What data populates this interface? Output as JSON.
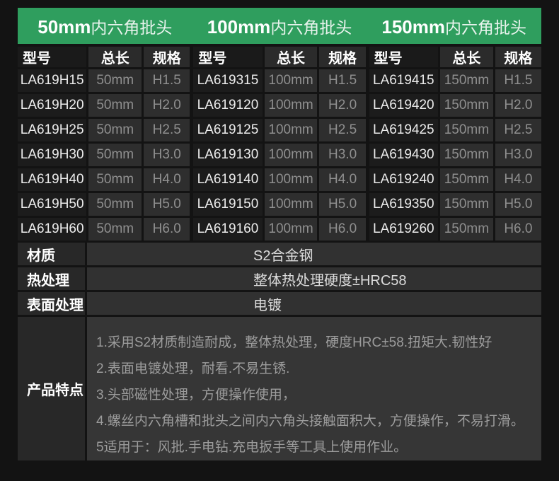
{
  "colors": {
    "accent_green": "#2f9e5e",
    "background": "#131313"
  },
  "groups": [
    {
      "title_size": "50mm",
      "title_suffix": "内六角批头",
      "headers": [
        "型号",
        "总长",
        "规格"
      ],
      "rows": [
        [
          "LA619H15",
          "50mm",
          "H1.5"
        ],
        [
          "LA619H20",
          "50mm",
          "H2.0"
        ],
        [
          "LA619H25",
          "50mm",
          "H2.5"
        ],
        [
          "LA619H30",
          "50mm",
          "H3.0"
        ],
        [
          "LA619H40",
          "50mm",
          "H4.0"
        ],
        [
          "LA619H50",
          "50mm",
          "H5.0"
        ],
        [
          "LA619H60",
          "50mm",
          "H6.0"
        ]
      ]
    },
    {
      "title_size": "100mm",
      "title_suffix": "内六角批头",
      "headers": [
        "型号",
        "总长",
        "规格"
      ],
      "rows": [
        [
          "LA619315",
          "100mm",
          "H1.5"
        ],
        [
          "LA619120",
          "100mm",
          "H2.0"
        ],
        [
          "LA619125",
          "100mm",
          "H2.5"
        ],
        [
          "LA619130",
          "100mm",
          "H3.0"
        ],
        [
          "LA619140",
          "100mm",
          "H4.0"
        ],
        [
          "LA619150",
          "100mm",
          "H5.0"
        ],
        [
          "LA619160",
          "100mm",
          "H6.0"
        ]
      ]
    },
    {
      "title_size": "150mm",
      "title_suffix": "内六角批头",
      "headers": [
        "型号",
        "总长",
        "规格"
      ],
      "rows": [
        [
          "LA619415",
          "150mm",
          "H1.5"
        ],
        [
          "LA619420",
          "150mm",
          "H2.0"
        ],
        [
          "LA619425",
          "150mm",
          "H2.5"
        ],
        [
          "LA619430",
          "150mm",
          "H3.0"
        ],
        [
          "LA619240",
          "150mm",
          "H4.0"
        ],
        [
          "LA619350",
          "150mm",
          "H5.0"
        ],
        [
          "LA619260",
          "150mm",
          "H6.0"
        ]
      ]
    }
  ],
  "specs": [
    {
      "label": "材质",
      "value": "S2合金钢"
    },
    {
      "label": "热处理",
      "value": "整体热处理硬度±HRC58"
    },
    {
      "label": "表面处理",
      "value": "电镀"
    }
  ],
  "features": {
    "label": "产品特点",
    "lines": [
      "1.采用S2材质制造耐成，整体热处理，硬度HRC±58.扭矩大.韧性好",
      "2.表面电镀处理，耐看.不易生锈.",
      "3.头部磁性处理，方便操作使用，",
      "4.螺丝内六角槽和批头之间内六角头接触面积大，方便操作，不易打滑。",
      "5适用于：风批.手电钻.充电扳手等工具上使用作业。"
    ]
  }
}
